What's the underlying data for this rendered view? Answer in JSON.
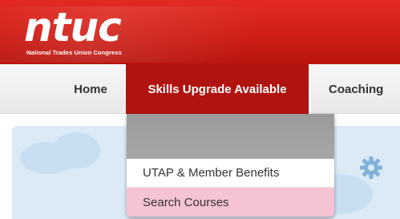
{
  "brand": {
    "logo_text": "ntuc",
    "tagline": "National Trades Union Congress"
  },
  "nav": {
    "items": [
      {
        "label": "Home"
      },
      {
        "label": "Skills Upgrade Available",
        "active": true
      },
      {
        "label": "Coaching"
      }
    ]
  },
  "dropdown": {
    "items": [
      {
        "label": "UTAP & Member Benefits"
      },
      {
        "label": "Search Courses",
        "highlighted": true
      }
    ]
  },
  "colors": {
    "brand_red": "#d01e17",
    "active_nav": "#b01410",
    "hover_pink": "#f6c3d5",
    "sky": "#dbeaf5"
  },
  "icons": {
    "settings": "gear-icon"
  }
}
